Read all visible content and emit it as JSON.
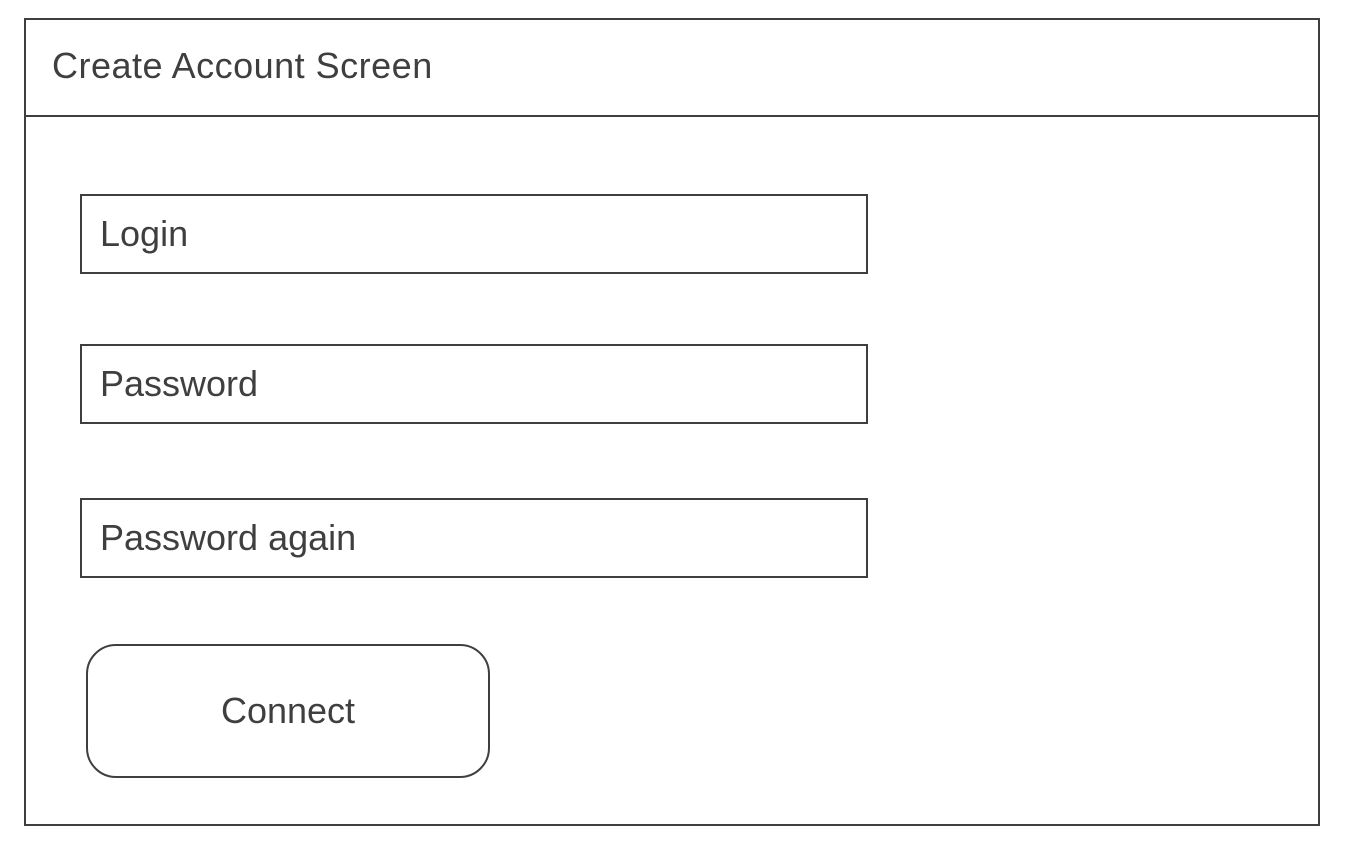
{
  "screen": {
    "title": "Create Account Screen"
  },
  "form": {
    "login_placeholder": "Login",
    "password_placeholder": "Password",
    "password_again_placeholder": "Password again",
    "connect_label": "Connect"
  },
  "colors": {
    "stroke": "#3f3f3f",
    "text": "#3f3f3f",
    "background": "#ffffff"
  }
}
